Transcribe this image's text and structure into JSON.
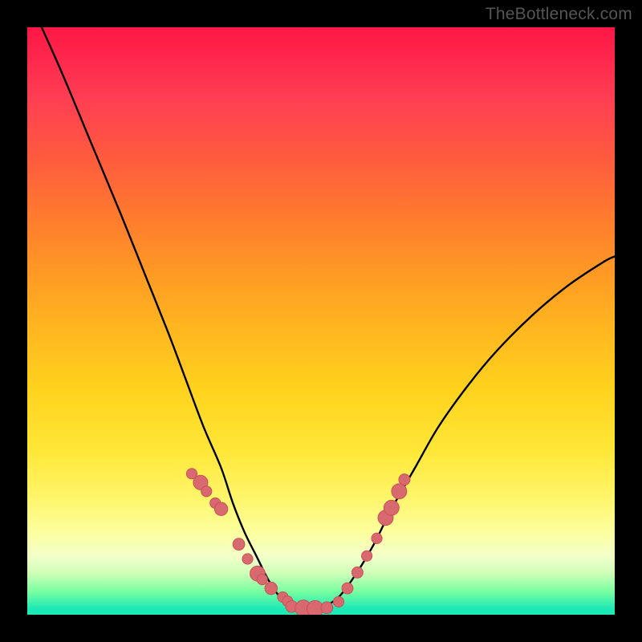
{
  "attribution": "TheBottleneck.com",
  "colors": {
    "curve": "#000000",
    "marker_fill": "#d86a6f",
    "marker_stroke": "#c94f57",
    "background_black": "#000000"
  },
  "chart_data": {
    "type": "line",
    "title": "",
    "xlabel": "",
    "ylabel": "",
    "xlim": [
      0,
      100
    ],
    "ylim": [
      0,
      100
    ],
    "grid": false,
    "legend": false,
    "note": "No axes, ticks, or numeric labels are rendered in the image. Curve traces are estimated from pixel geometry on a 0–100 normalized scale (y=0 at bottom, y=100 at top).",
    "series": [
      {
        "name": "left-branch",
        "kind": "curve",
        "x": [
          2,
          6,
          11,
          16,
          20,
          24,
          27,
          30,
          33,
          35,
          37,
          39,
          41,
          43,
          45
        ],
        "y": [
          101,
          92,
          80,
          68,
          58,
          48,
          40,
          32,
          25,
          19,
          14,
          10,
          6,
          3,
          1
        ]
      },
      {
        "name": "right-branch",
        "kind": "curve",
        "x": [
          50,
          53,
          56,
          59,
          62,
          66,
          70,
          75,
          80,
          86,
          92,
          98,
          100
        ],
        "y": [
          1,
          3,
          7,
          12,
          18,
          25,
          32,
          39,
          45,
          51,
          56,
          60,
          61
        ]
      },
      {
        "name": "markers-left",
        "kind": "scatter",
        "x": [
          28,
          29.5,
          30.5,
          32,
          33,
          36,
          37.5,
          39.2,
          40,
          41.5,
          43.5,
          44.3
        ],
        "y": [
          24,
          22.5,
          21,
          19,
          18,
          12,
          9.5,
          7,
          6,
          4.5,
          3,
          2.3
        ],
        "r": [
          3.2,
          4.4,
          3.2,
          3.2,
          4.0,
          3.6,
          3.2,
          4.6,
          3.2,
          3.8,
          3.2,
          3.2
        ]
      },
      {
        "name": "markers-bottom",
        "kind": "scatter",
        "x": [
          45,
          47,
          49,
          51,
          53
        ],
        "y": [
          1.4,
          1.1,
          1.0,
          1.2,
          2.2
        ],
        "r": [
          3.6,
          5.0,
          5.0,
          3.6,
          3.2
        ]
      },
      {
        "name": "markers-right",
        "kind": "scatter",
        "x": [
          54.5,
          56.2,
          57.8,
          59.5,
          61,
          62,
          63.3,
          64.2
        ],
        "y": [
          4.5,
          7.2,
          10,
          13,
          16.5,
          18.2,
          21,
          23
        ],
        "r": [
          3.4,
          3.4,
          3.2,
          3.2,
          4.6,
          4.6,
          4.6,
          3.4
        ]
      }
    ]
  }
}
